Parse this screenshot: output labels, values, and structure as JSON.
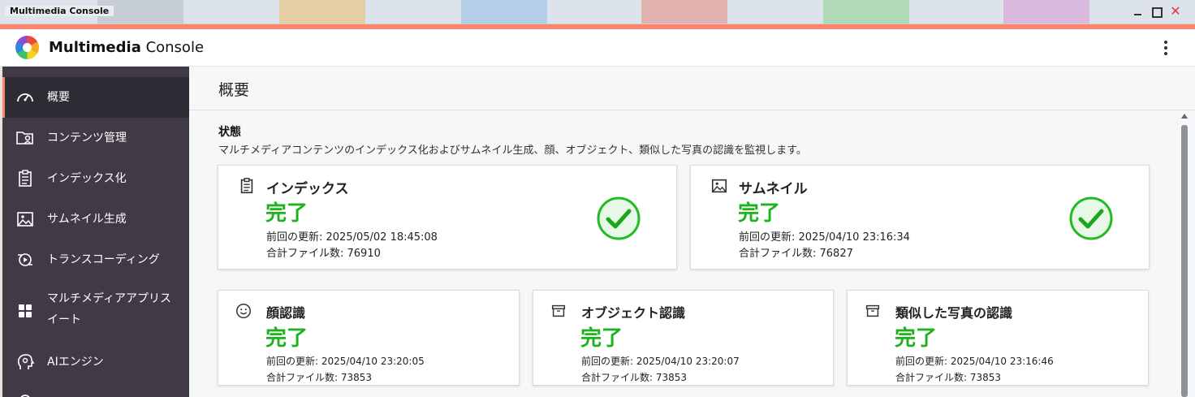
{
  "window": {
    "title": "Multimedia Console",
    "close_glyph": "✕"
  },
  "app": {
    "title_bold": "Multimedia",
    "title_rest": " Console",
    "logo_icon": "multimedia-console-logo",
    "menu_icon": "kebab-menu-icon"
  },
  "sidebar": {
    "items": [
      {
        "label": "概要",
        "icon": "gauge-icon",
        "active": true
      },
      {
        "label": "コンテンツ管理",
        "icon": "folder-user-icon"
      },
      {
        "label": "インデックス化",
        "icon": "clipboard-icon"
      },
      {
        "label": "サムネイル生成",
        "icon": "image-icon"
      },
      {
        "label": "トランスコーディング",
        "icon": "transcode-icon"
      },
      {
        "label": "マルチメディアアプリス",
        "label2": "イート",
        "icon": "apps-grid-icon"
      },
      {
        "label": "AIエンジン",
        "icon": "ai-head-icon"
      }
    ]
  },
  "main": {
    "page_title": "概要",
    "section": {
      "title": "状態",
      "description": "マルチメディアコンテンツのインデックス化およびサムネイル生成、顔、オブジェクト、類似した写真の認識を監視します。"
    },
    "cards": [
      {
        "title": "インデックス",
        "icon": "clipboard-icon",
        "status": "完了",
        "last_update": "前回の更新:  2025/05/02 18:45:08",
        "total_files": "合計ファイル数:  76910",
        "check_icon": "check-circle-icon"
      },
      {
        "title": "サムネイル",
        "icon": "image-icon",
        "status": "完了",
        "last_update": "前回の更新:  2025/04/10 23:16:34",
        "total_files": "合計ファイル数:  76827",
        "check_icon": "check-circle-icon"
      },
      {
        "title": "顔認識",
        "icon": "smiley-icon",
        "status": "完了",
        "last_update": "前回の更新:  2025/04/10 23:20:05",
        "total_files": "合計ファイル数:  73853"
      },
      {
        "title": "オブジェクト認識",
        "icon": "archive-box-icon",
        "status": "完了",
        "last_update": "前回の更新:  2025/04/10 23:20:07",
        "total_files": "合計ファイル数:  73853"
      },
      {
        "title": "類似した写真の認識",
        "icon": "archive-box-icon",
        "status": "完了",
        "last_update": "前回の更新:  2025/04/10 23:16:46",
        "total_files": "合計ファイル数:  73853"
      }
    ]
  },
  "colors": {
    "accent": "#fb846b",
    "success": "#1db31d",
    "sidebar_bg": "#3f3a45",
    "sidebar_active": "#2f2b34"
  }
}
